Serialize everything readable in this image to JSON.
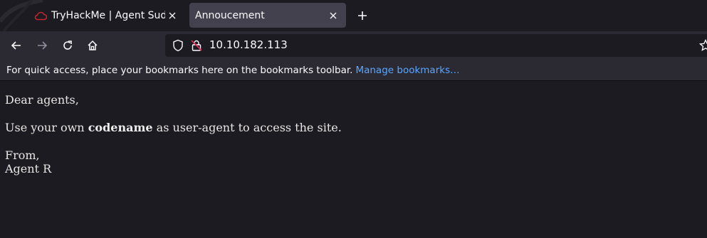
{
  "tabs": [
    {
      "title": "TryHackMe | Agent Sudo",
      "favicon": "tryhackme-cloud-icon",
      "active": false
    },
    {
      "title": "Annoucement",
      "favicon": "",
      "active": true
    }
  ],
  "nav": {
    "url": "10.10.182.113"
  },
  "bookmarks_bar": {
    "message": "For quick access, place your bookmarks here on the bookmarks toolbar.",
    "manage_link": "Manage bookmarks…"
  },
  "page": {
    "greeting": "Dear agents,",
    "line_before": "Use your own ",
    "line_bold": "codename",
    "line_after": " as user-agent to access the site.",
    "closing": "From,",
    "signature": "Agent R"
  },
  "colors": {
    "link": "#5aa7ff",
    "active_tab": "#42414d",
    "toolbar": "#2b2a33",
    "background": "#1c1b22",
    "favicon_red": "#c0272d"
  }
}
